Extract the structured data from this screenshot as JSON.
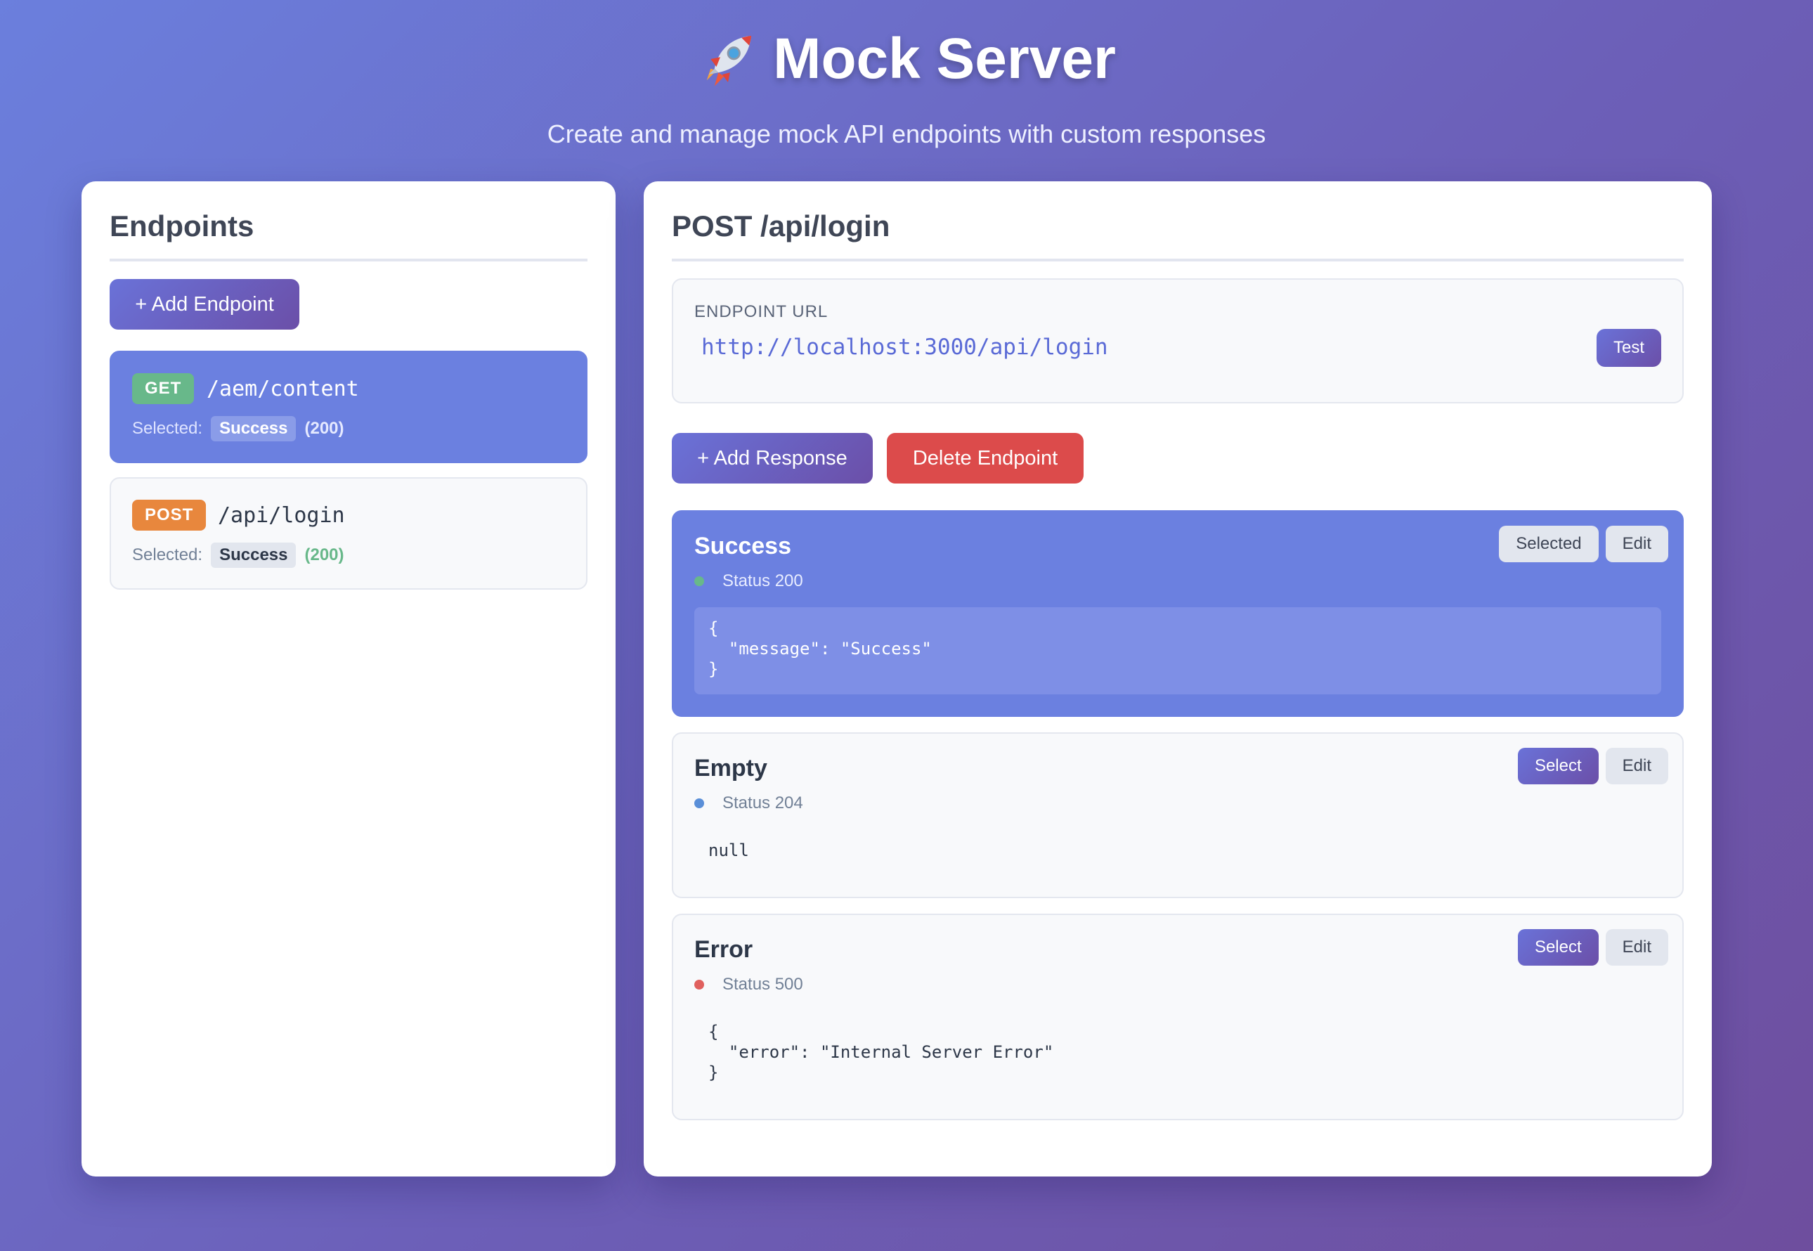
{
  "header": {
    "title": "Mock Server",
    "subtitle": "Create and manage mock API endpoints with custom responses",
    "icon": "rocket-icon"
  },
  "sidebar": {
    "title": "Endpoints",
    "add_label": "+ Add Endpoint",
    "endpoints": [
      {
        "method": "GET",
        "path": "/aem/content",
        "selected_label": "Selected:",
        "selected_name": "Success",
        "selected_code": "(200)",
        "active": true
      },
      {
        "method": "POST",
        "path": "/api/login",
        "selected_label": "Selected:",
        "selected_name": "Success",
        "selected_code": "(200)",
        "active": false
      }
    ]
  },
  "detail": {
    "title": "POST /api/login",
    "url_label": "ENDPOINT URL",
    "url": "http://localhost:3000/api/login",
    "test_label": "Test",
    "add_response_label": "+ Add Response",
    "delete_label": "Delete Endpoint",
    "responses": [
      {
        "name": "Success",
        "status": "Status 200",
        "body": "{\n  \"message\": \"Success\"\n}",
        "select_label": "Selected",
        "edit_label": "Edit",
        "active": true
      },
      {
        "name": "Empty",
        "status": "Status 204",
        "body": "null",
        "select_label": "Select",
        "edit_label": "Edit",
        "active": false
      },
      {
        "name": "Error",
        "status": "Status 500",
        "body": "{\n  \"error\": \"Internal Server Error\"\n}",
        "select_label": "Select",
        "edit_label": "Edit",
        "active": false
      }
    ]
  },
  "colors": {
    "accent": "#6b80e0",
    "get": "#68b88a",
    "post": "#e8873d",
    "danger": "#dc4b4b"
  }
}
